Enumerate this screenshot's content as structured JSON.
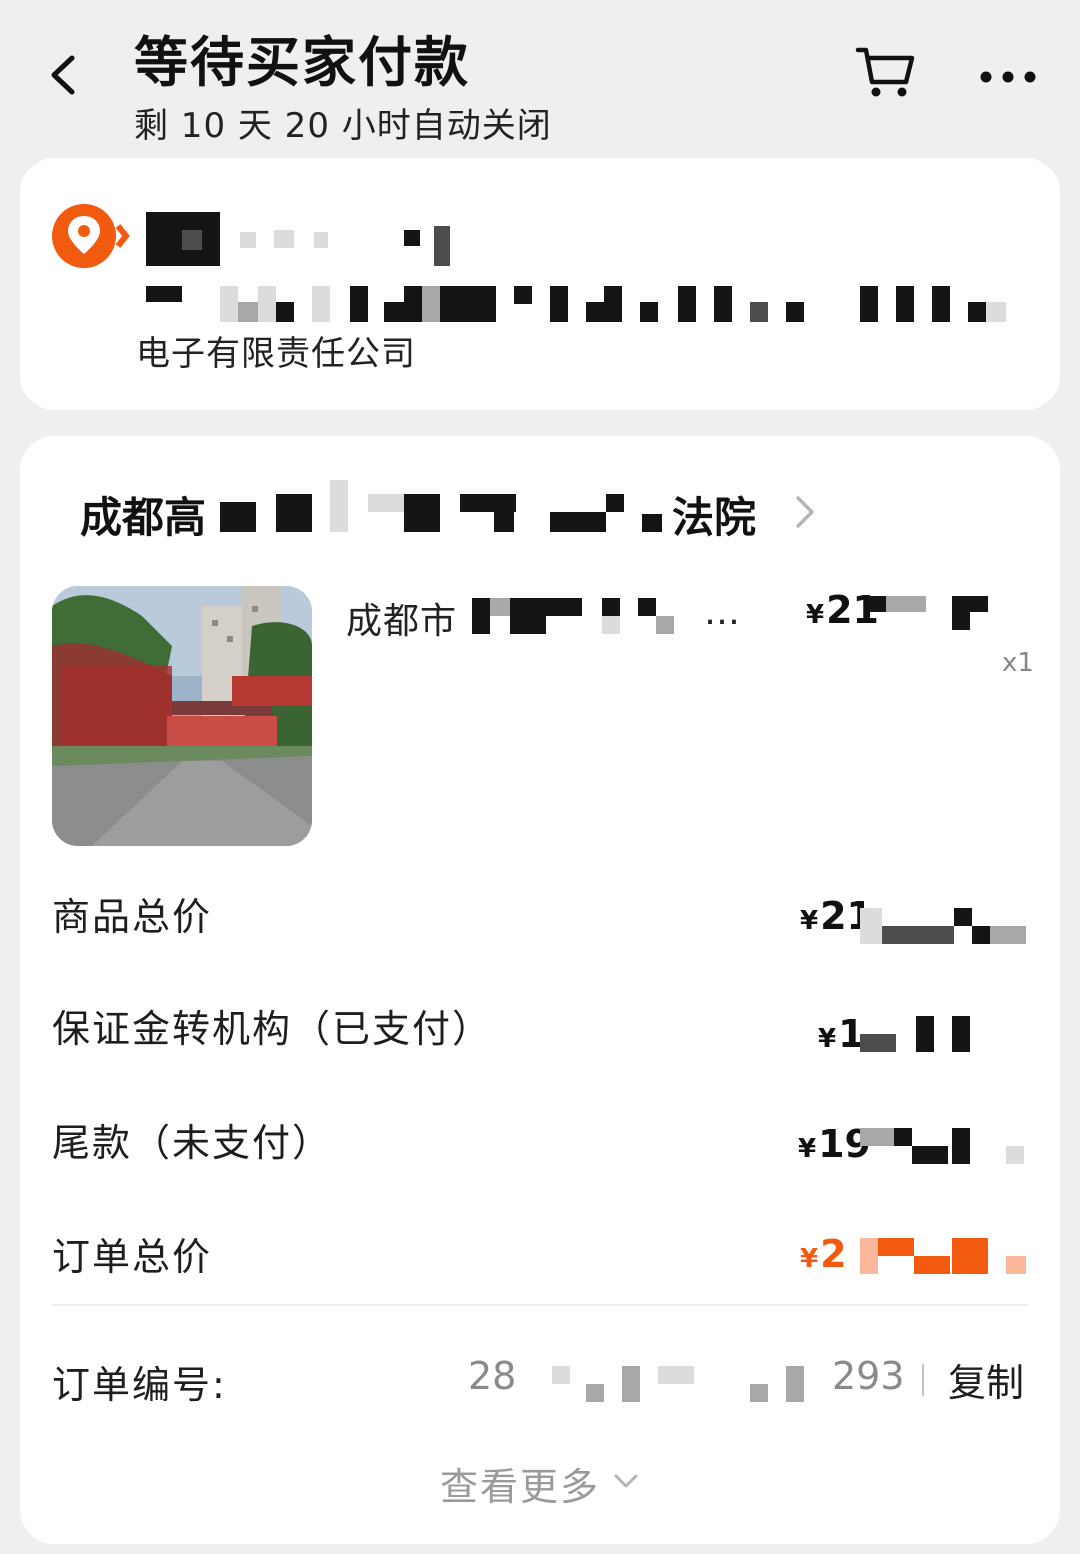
{
  "header": {
    "title": "等待买家付款",
    "subtitle": "剩 10 天 20 小时自动关闭"
  },
  "address": {
    "line3": "电子有限责任公司"
  },
  "shop": {
    "name_prefix": "成都高",
    "name_suffix": "法院"
  },
  "product": {
    "title_prefix": "成都市",
    "title_suffix": "…",
    "price_symbol": "¥",
    "price_visible": "21",
    "quantity": "x1"
  },
  "summary": {
    "goods_total_label": "商品总价",
    "goods_total_value": "21",
    "deposit_label": "保证金转机构（已支付）",
    "deposit_value": "1",
    "balance_label": "尾款（未支付）",
    "balance_value": "19",
    "order_total_label": "订单总价",
    "order_total_value": "2",
    "currency": "¥"
  },
  "order": {
    "number_label": "订单编号:",
    "number_start": "28",
    "number_end": "293",
    "copy_label": "复制"
  },
  "more": {
    "label": "查看更多"
  },
  "colors": {
    "accent": "#f25a0f",
    "background": "#efefef",
    "card": "#ffffff"
  },
  "icons": [
    "back-arrow-icon",
    "cart-icon",
    "more-dots-icon",
    "location-pin-icon",
    "chevron-right-icon",
    "chevron-down-icon"
  ]
}
